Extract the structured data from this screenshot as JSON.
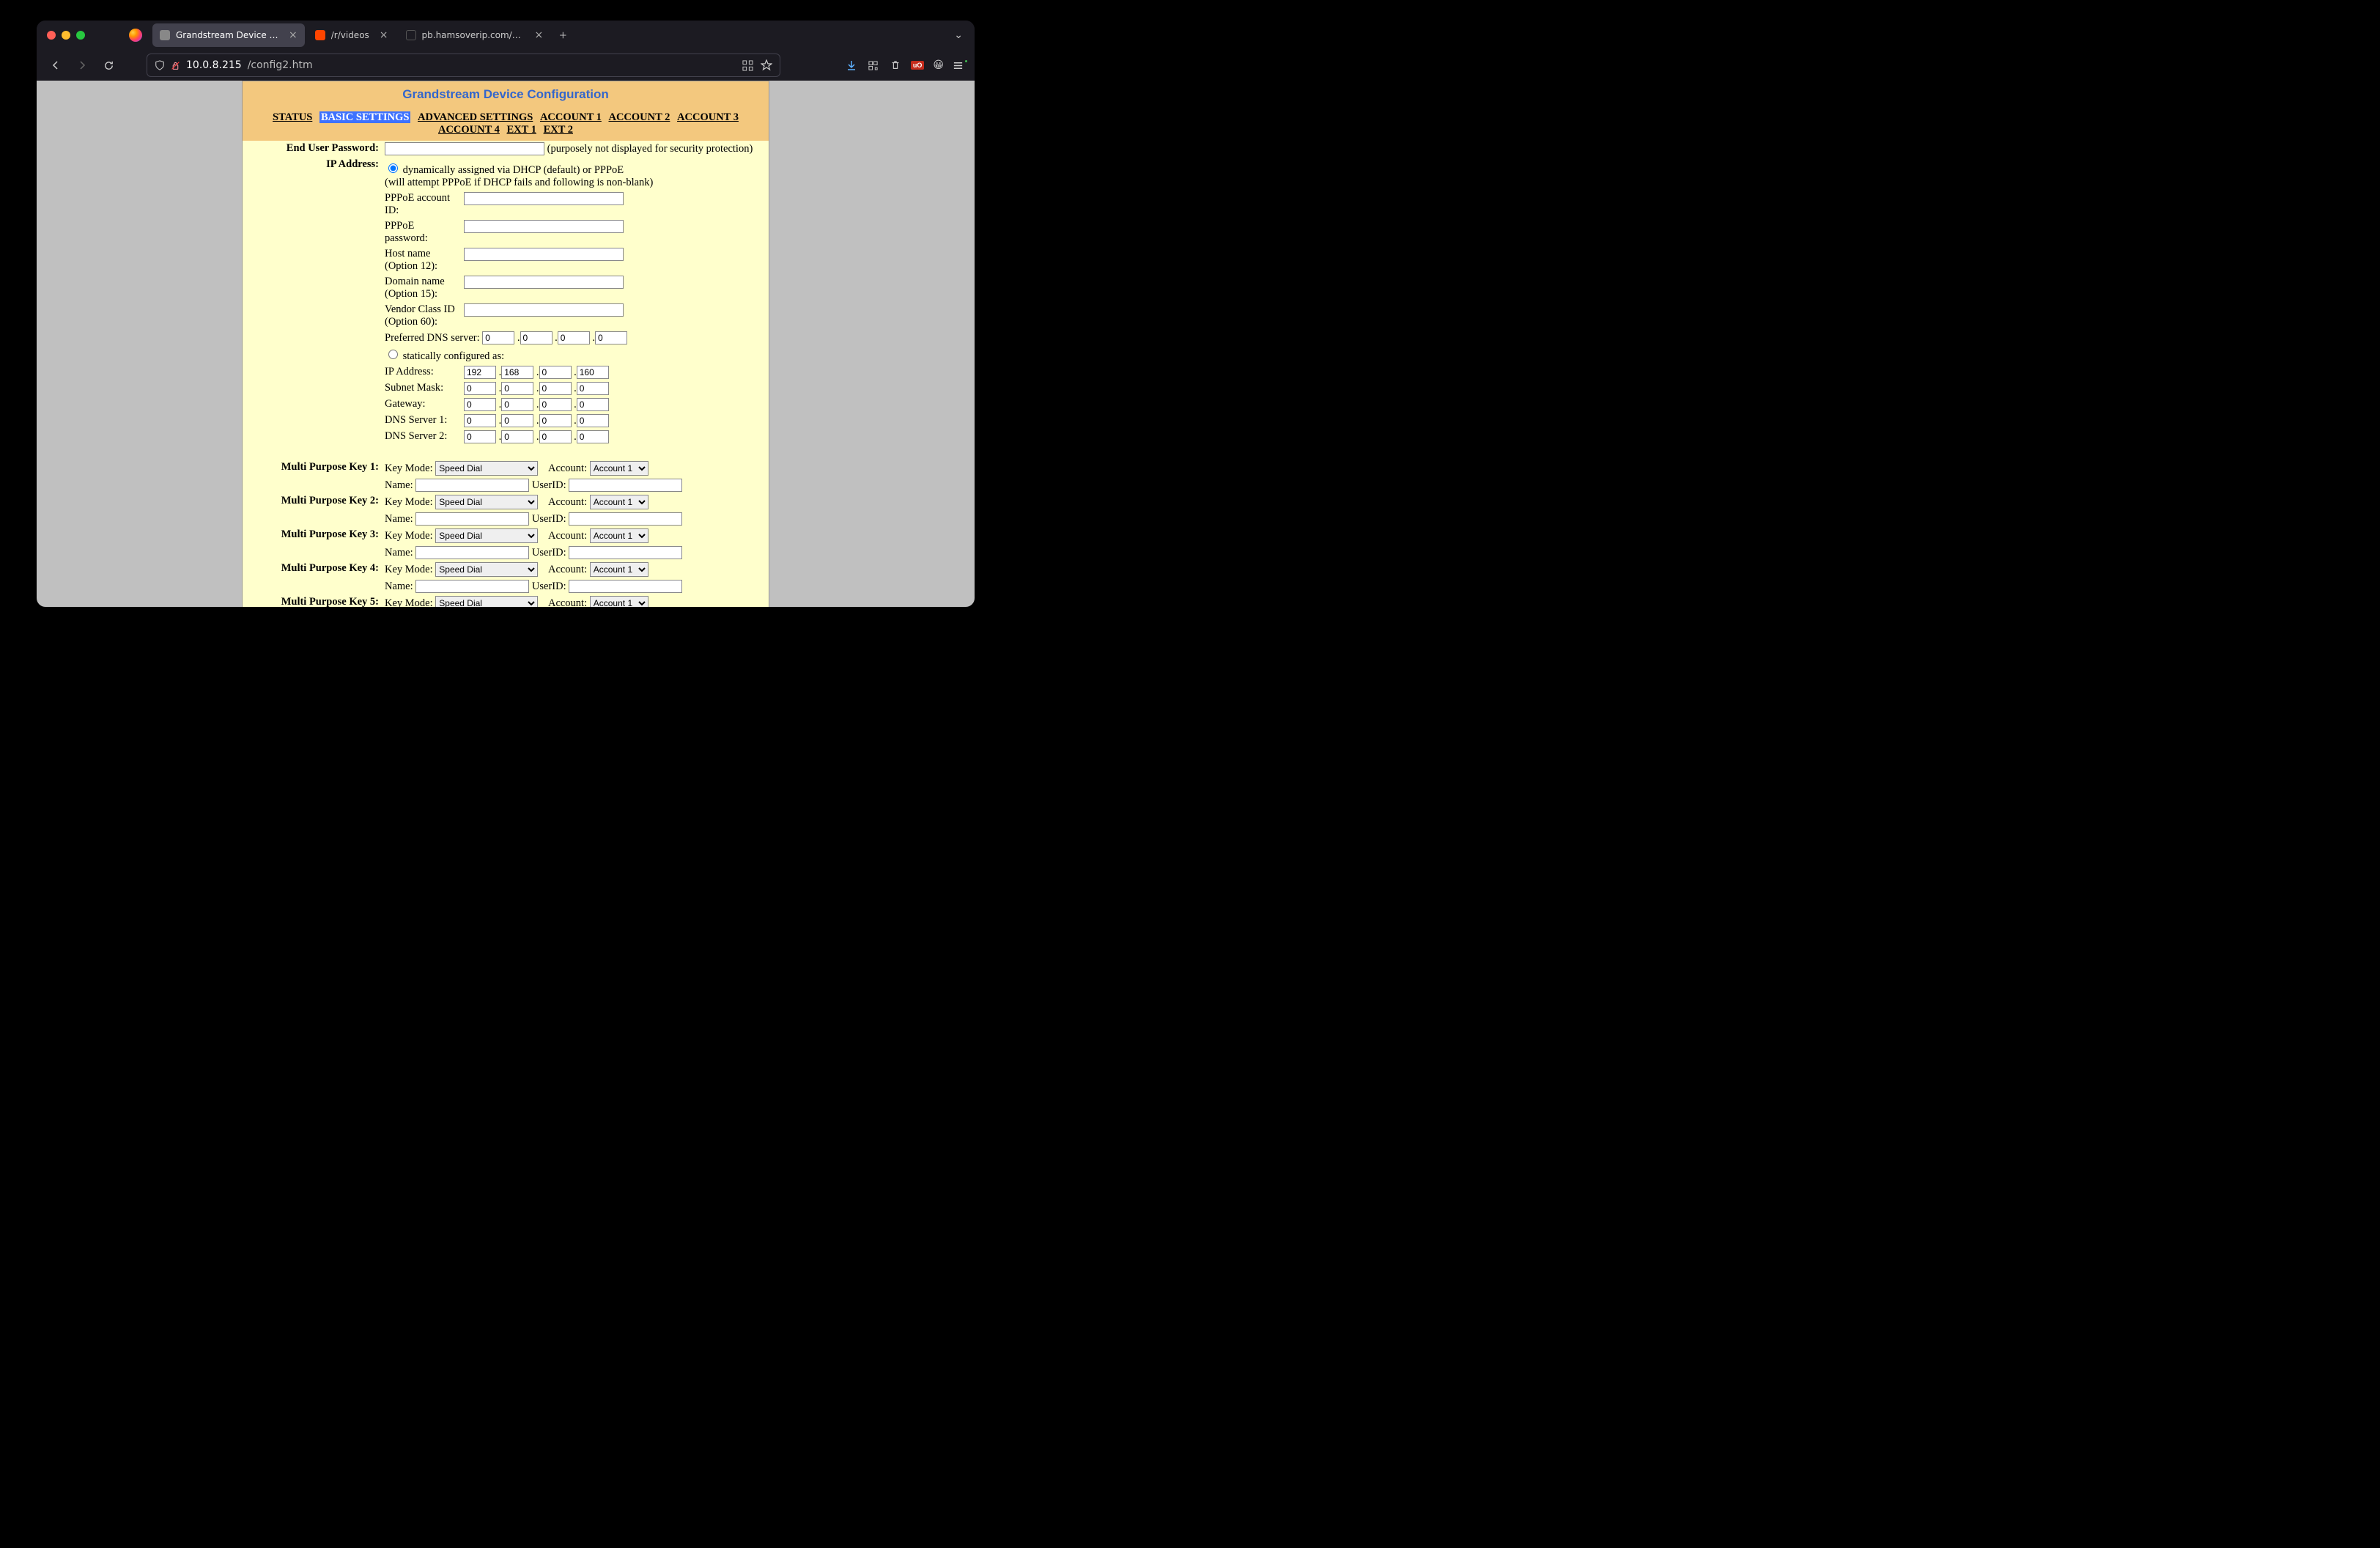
{
  "browser": {
    "tabs": [
      {
        "title": "Grandstream Device Configuration",
        "active": true,
        "favicon": "#888"
      },
      {
        "title": "/r/videos",
        "active": false,
        "favicon": "#ff4500"
      },
      {
        "title": "pb.hamsoverip.com/diy",
        "active": false,
        "favicon": "transparent"
      }
    ],
    "url_ip": "10.0.8.215",
    "url_path": "/config2.htm"
  },
  "page": {
    "title": "Grandstream Device Configuration",
    "nav": [
      "STATUS",
      "BASIC SETTINGS",
      "ADVANCED SETTINGS",
      "ACCOUNT 1",
      "ACCOUNT 2",
      "ACCOUNT 3",
      "ACCOUNT 4",
      "EXT 1",
      "EXT 2"
    ],
    "nav_active": "BASIC SETTINGS",
    "labels": {
      "end_user_password": "End User Password:",
      "password_note": "(purposely not displayed for security protection)",
      "ip_address": "IP Address:",
      "dhcp_radio": "dynamically assigned via DHCP (default) or PPPoE",
      "dhcp_note": "(will attempt PPPoE if DHCP fails and following is non-blank)",
      "pppoe_id": "PPPoE account ID:",
      "pppoe_pw": "PPPoE password:",
      "hostname": "Host name (Option 12):",
      "domainname": "Domain name (Option 15):",
      "vendorclass": "Vendor Class ID (Option 60):",
      "pref_dns": "Preferred DNS server:",
      "static_radio": "statically configured as:",
      "static_ip": "IP Address:",
      "subnet": "Subnet Mask:",
      "gateway": "Gateway:",
      "dns1": "DNS Server 1:",
      "dns2": "DNS Server 2:",
      "key_mode": "Key Mode:",
      "account": "Account:",
      "name": "Name:",
      "userid": "UserID:"
    },
    "values": {
      "end_user_password": "",
      "pppoe_id": "",
      "pppoe_pw": "",
      "hostname": "",
      "domainname": "",
      "vendorclass": "",
      "pref_dns": [
        "0",
        "0",
        "0",
        "0"
      ],
      "ip_mode": "dhcp",
      "static": {
        "ip": [
          "192",
          "168",
          "0",
          "160"
        ],
        "subnet": [
          "0",
          "0",
          "0",
          "0"
        ],
        "gateway": [
          "0",
          "0",
          "0",
          "0"
        ],
        "dns1": [
          "0",
          "0",
          "0",
          "0"
        ],
        "dns2": [
          "0",
          "0",
          "0",
          "0"
        ]
      }
    },
    "mpk": [
      {
        "label": "Multi Purpose Key 1:",
        "mode": "Speed Dial",
        "account": "Account 1",
        "name": "",
        "userid": ""
      },
      {
        "label": "Multi Purpose Key 2:",
        "mode": "Speed Dial",
        "account": "Account 1",
        "name": "",
        "userid": ""
      },
      {
        "label": "Multi Purpose Key 3:",
        "mode": "Speed Dial",
        "account": "Account 1",
        "name": "",
        "userid": ""
      },
      {
        "label": "Multi Purpose Key 4:",
        "mode": "Speed Dial",
        "account": "Account 1",
        "name": "",
        "userid": ""
      },
      {
        "label": "Multi Purpose Key 5:",
        "mode": "Speed Dial",
        "account": "Account 1",
        "name": "",
        "userid": ""
      }
    ]
  }
}
